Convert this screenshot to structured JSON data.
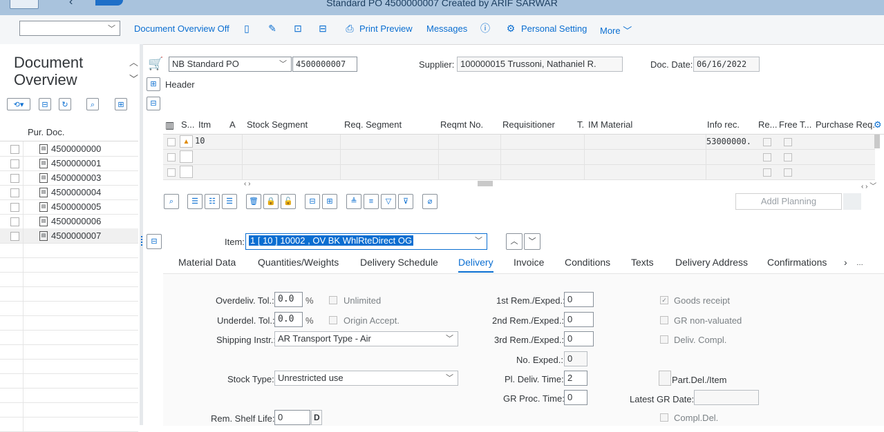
{
  "window": {
    "title": "Standard PO 4500000007 Created by ARIF SARWAR"
  },
  "toolbar": {
    "command_value": "",
    "doc_overview_off": "Document Overview Off",
    "print_preview": "Print Preview",
    "messages": "Messages",
    "personal_setting": "Personal Setting",
    "more": "More"
  },
  "left": {
    "title": "Document Overview",
    "column_header": "Pur. Doc.",
    "docs": [
      "4500000000",
      "4500000001",
      "4500000003",
      "4500000004",
      "4500000005",
      "4500000006",
      "4500000007"
    ]
  },
  "header": {
    "po_type": "NB Standard PO",
    "po_number": "4500000007",
    "supplier_label": "Supplier:",
    "supplier_value": "100000015 Trussoni, Nathaniel R.",
    "doc_date_label": "Doc. Date:",
    "doc_date_value": "06/16/2022",
    "header_label": "Header"
  },
  "grid": {
    "columns": [
      "S...",
      "Itm",
      "A",
      "Stock Segment",
      "Req. Segment",
      "Reqmt No.",
      "Requisitioner",
      "T.",
      "IM Material",
      "Info rec.",
      "Re...",
      "Free",
      "T...",
      "Purchase Req."
    ],
    "rows": [
      {
        "itm": "10",
        "info_rec": "53000000."
      },
      {
        "itm": "",
        "info_rec": ""
      },
      {
        "itm": "",
        "info_rec": ""
      }
    ],
    "addl_planning": "Addl Planning"
  },
  "item": {
    "label": "Item:",
    "value": "1 [ 10 ] 10002 , OV BK WhlRteDirect OG"
  },
  "tabs": [
    "Material Data",
    "Quantities/Weights",
    "Delivery Schedule",
    "Delivery",
    "Invoice",
    "Conditions",
    "Texts",
    "Delivery Address",
    "Confirmations"
  ],
  "selected_tab": "Delivery",
  "delivery": {
    "overdeliv_label": "Overdeliv. Tol.:",
    "overdeliv_value": "0.0",
    "underdel_label": "Underdel. Tol.:",
    "underdel_value": "0.0",
    "percent": "%",
    "unlimited": "Unlimited",
    "origin_accept": "Origin Accept.",
    "shipping_label": "Shipping Instr.:",
    "shipping_value": "AR Transport Type - Air",
    "stock_type_label": "Stock Type:",
    "stock_type_value": "Unrestricted use",
    "rem_shelf_label": "Rem. Shelf Life:",
    "rem_shelf_value": "0",
    "rem_shelf_unit": "D",
    "rem1_label": "1st Rem./Exped.:",
    "rem1_value": "0",
    "rem2_label": "2nd Rem./Exped.:",
    "rem2_value": "0",
    "rem3_label": "3rd Rem./Exped.:",
    "rem3_value": "0",
    "no_exped_label": "No. Exped.:",
    "no_exped_value": "0",
    "pl_deliv_label": "Pl. Deliv. Time:",
    "pl_deliv_value": "2",
    "gr_proc_label": "GR Proc. Time:",
    "gr_proc_value": "0",
    "goods_receipt": "Goods receipt",
    "gr_nonvalued": "GR non-valuated",
    "deliv_compl": "Deliv. Compl.",
    "part_del": "Part.Del./Item",
    "latest_gr_label": "Latest GR Date:",
    "latest_gr_value": "",
    "compl_del": "Compl.Del."
  }
}
